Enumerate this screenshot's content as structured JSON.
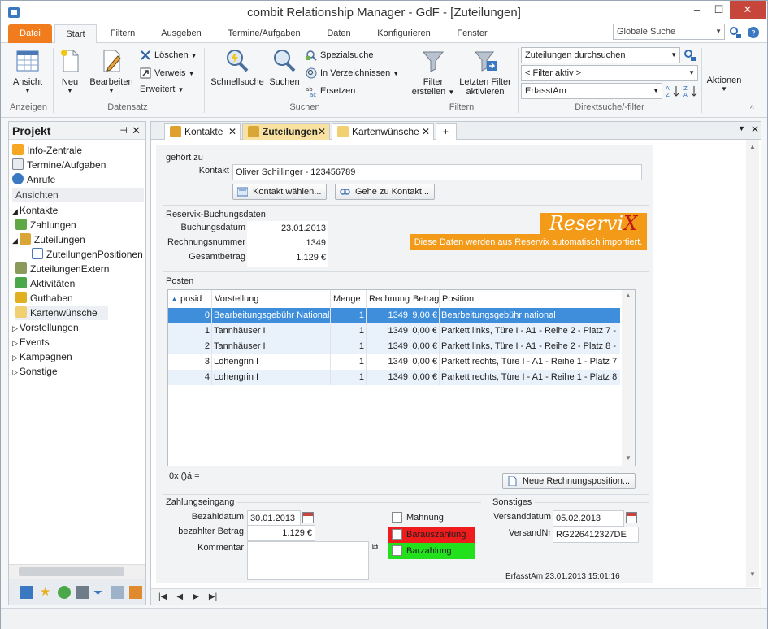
{
  "window": {
    "title": "combit Relationship Manager - GdF - [Zuteilungen]",
    "min": "–",
    "max": "☐",
    "close": "✕"
  },
  "ribbon_tabs": [
    "Datei",
    "Start",
    "Filtern",
    "Ausgeben",
    "Termine/Aufgaben",
    "Daten",
    "Konfigurieren",
    "Fenster"
  ],
  "global_search": {
    "placeholder": "Globale Suche"
  },
  "ribbon": {
    "anzeigen": {
      "ansicht": "Ansicht",
      "label": "Anzeigen"
    },
    "datensatz": {
      "neu": "Neu",
      "bearbeiten": "Bearbeiten",
      "loeschen": "Löschen",
      "verweis": "Verweis",
      "erweitert": "Erweitert",
      "label": "Datensatz"
    },
    "suchen": {
      "schnellsuche": "Schnellsuche",
      "suchen": "Suchen",
      "spezialsuche": "Spezialsuche",
      "in_verzeichnissen": "In Verzeichnissen",
      "ersetzen": "Ersetzen",
      "label": "Suchen"
    },
    "filtern": {
      "erstellen1": "Filter",
      "erstellen2": "erstellen",
      "aktivieren1": "Letzten Filter",
      "aktivieren2": "aktivieren",
      "label": "Filtern"
    },
    "direktsuche": {
      "search_placeholder": "Zuteilungen durchsuchen",
      "filter": "< Filter aktiv >",
      "field": "ErfasstAm",
      "label": "Direktsuche/-filter"
    },
    "aktionen": "Aktionen"
  },
  "left_panel": {
    "title": "Projekt",
    "pin": "📌",
    "close": "✕",
    "items": [
      {
        "label": "Info-Zentrale"
      },
      {
        "label": "Termine/Aufgaben"
      },
      {
        "label": "Anrufe"
      }
    ],
    "section": "Ansichten",
    "tree": [
      {
        "label": "Kontakte"
      },
      {
        "label": "Zahlungen"
      },
      {
        "label": "Zuteilungen"
      },
      {
        "label": "ZuteilungenPositionen"
      },
      {
        "label": "ZuteilungenExtern"
      },
      {
        "label": "Aktivitäten"
      },
      {
        "label": "Guthaben"
      },
      {
        "label": "Kartenwünsche"
      },
      {
        "label": "Vorstellungen"
      },
      {
        "label": "Events"
      },
      {
        "label": "Kampagnen"
      },
      {
        "label": "Sonstige"
      }
    ]
  },
  "doc_tabs": [
    {
      "label": "Kontakte"
    },
    {
      "label": "Zuteilungen"
    },
    {
      "label": "Kartenwünsche"
    }
  ],
  "form": {
    "gehoert_zu": "gehört zu",
    "kontakt_label": "Kontakt",
    "kontakt_value": "Oliver Schillinger - 123456789",
    "kontakt_waehlen": "Kontakt wählen...",
    "gehe_zu_kontakt": "Gehe zu Kontakt...",
    "reservix_title": "Reservix-Buchungsdaten",
    "buchungsdatum_label": "Buchungsdatum",
    "buchungsdatum": "23.01.2013",
    "rechnungsnummer_label": "Rechnungsnummer",
    "rechnungsnummer": "1349",
    "gesamtbetrag_label": "Gesamtbetrag",
    "gesamtbetrag": "1.129 €",
    "logo_a": "Reservi",
    "logo_b": "X",
    "logo_sub": "Diese Daten werden aus Reservix automatisch importiert.",
    "posten": "Posten",
    "grid": {
      "headers": [
        "posid",
        "Vorstellung",
        "Menge",
        "Rechnung",
        "Betrag",
        "Position"
      ],
      "rows": [
        [
          "0",
          "Bearbeitungsgebühr National",
          "1",
          "1349",
          "9,00 €",
          "Bearbeitungsgebühr national"
        ],
        [
          "1",
          "Tannhäuser I",
          "1",
          "1349",
          "0,00 €",
          "Parkett links, Türe I - A1 - Reihe 2 - Platz 7 -"
        ],
        [
          "2",
          "Tannhäuser I",
          "1",
          "1349",
          "0,00 €",
          "Parkett links, Türe I - A1 - Reihe 2 - Platz 8 -"
        ],
        [
          "3",
          "Lohengrin I",
          "1",
          "1349",
          "0,00 €",
          "Parkett rechts, Türe I - A1 - Reihe 1 - Platz 7"
        ],
        [
          "4",
          "Lohengrin I",
          "1",
          "1349",
          "0,00 €",
          "Parkett rechts, Türe I - A1 - Reihe 1 - Platz 8"
        ]
      ]
    },
    "grid_footer": "0x  ()á  =",
    "neue_position": "Neue Rechnungsposition...",
    "zahlungseingang": "Zahlungseingang",
    "bezahldatum_label": "Bezahldatum",
    "bezahldatum": "30.01.2013",
    "bezahlter_betrag_label": "bezahlter Betrag",
    "bezahlter_betrag": "1.129 €",
    "kommentar_label": "Kommentar",
    "mahnung": "Mahnung",
    "barauszahlung": "Barauszahlung",
    "barzahlung": "Barzahlung",
    "sonstiges": "Sonstiges",
    "versanddatum_label": "Versanddatum",
    "versanddatum": "05.02.2013",
    "versandnr_label": "VersandNr",
    "versandnr": "RG226412327DE",
    "erfasstam": "ErfasstAm  23.01.2013 15:01:16"
  },
  "colors": {
    "accent": "#f07c1e",
    "selection": "#3e8edb",
    "red": "#ee1c1c",
    "green": "#22e01c"
  }
}
